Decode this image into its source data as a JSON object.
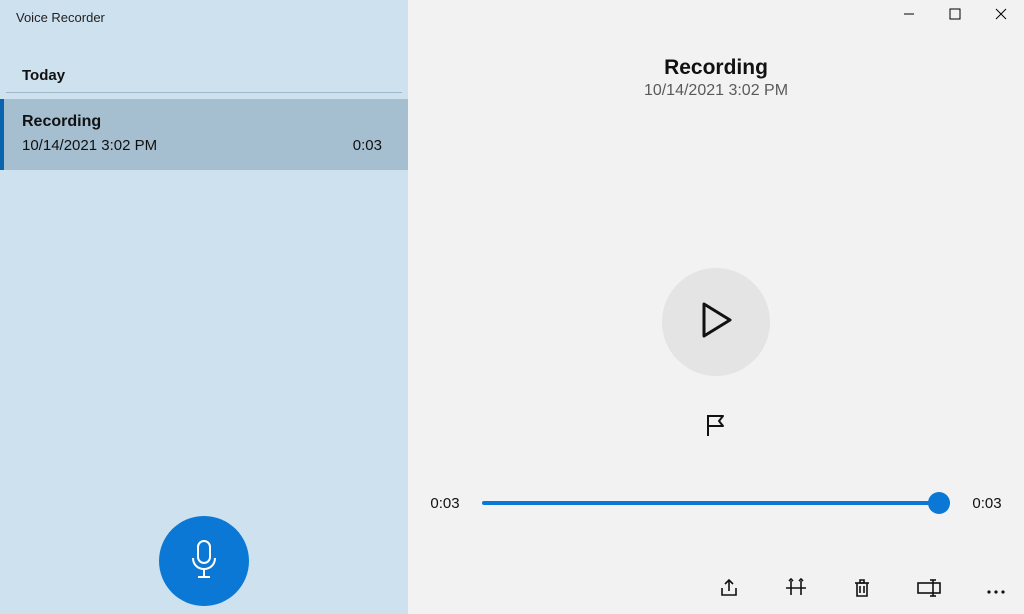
{
  "app_title": "Voice Recorder",
  "sidebar": {
    "section": "Today",
    "items": [
      {
        "name": "Recording",
        "date": "10/14/2021 3:02 PM",
        "duration": "0:03",
        "selected": true
      }
    ]
  },
  "main": {
    "title": "Recording",
    "date": "10/14/2021 3:02 PM",
    "current_time": "0:03",
    "total_time": "0:03"
  },
  "icons": {
    "minimize": "minimize-icon",
    "maximize": "maximize-icon",
    "close": "close-icon",
    "mic": "microphone-icon",
    "play": "play-icon",
    "flag": "flag-icon",
    "share": "share-icon",
    "trim": "trim-icon",
    "delete": "trash-icon",
    "rename": "rename-icon",
    "more": "more-icon"
  }
}
